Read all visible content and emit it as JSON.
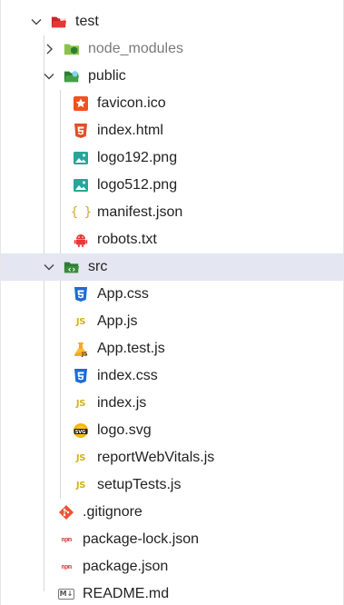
{
  "tree": {
    "root": {
      "name": "test",
      "icon": "folder-open-red-icon",
      "expanded": true
    },
    "items": [
      {
        "name": "node_modules",
        "type": "folder",
        "icon": "folder-node-icon",
        "expanded": false
      },
      {
        "name": "public",
        "type": "folder",
        "icon": "folder-public-icon",
        "expanded": true
      },
      {
        "name": "favicon.ico",
        "type": "file",
        "icon": "favicon-icon"
      },
      {
        "name": "index.html",
        "type": "file",
        "icon": "html-icon"
      },
      {
        "name": "logo192.png",
        "type": "file",
        "icon": "image-icon"
      },
      {
        "name": "logo512.png",
        "type": "file",
        "icon": "image-icon"
      },
      {
        "name": "manifest.json",
        "type": "file",
        "icon": "json-braces-icon",
        "glyph": "{ }"
      },
      {
        "name": "robots.txt",
        "type": "file",
        "icon": "robot-icon"
      },
      {
        "name": "src",
        "type": "folder",
        "icon": "folder-src-icon",
        "expanded": true,
        "selected": true
      },
      {
        "name": "App.css",
        "type": "file",
        "icon": "css-icon"
      },
      {
        "name": "App.js",
        "type": "file",
        "icon": "js-icon",
        "glyph": "JS"
      },
      {
        "name": "App.test.js",
        "type": "file",
        "icon": "test-js-icon"
      },
      {
        "name": "index.css",
        "type": "file",
        "icon": "css-icon"
      },
      {
        "name": "index.js",
        "type": "file",
        "icon": "js-icon",
        "glyph": "JS"
      },
      {
        "name": "logo.svg",
        "type": "file",
        "icon": "svg-icon"
      },
      {
        "name": "reportWebVitals.js",
        "type": "file",
        "icon": "js-icon",
        "glyph": "JS"
      },
      {
        "name": "setupTests.js",
        "type": "file",
        "icon": "js-icon",
        "glyph": "JS"
      },
      {
        "name": ".gitignore",
        "type": "file",
        "icon": "git-icon"
      },
      {
        "name": "package-lock.json",
        "type": "file",
        "icon": "npm-icon",
        "glyph": "npm"
      },
      {
        "name": "package.json",
        "type": "file",
        "icon": "npm-icon",
        "glyph": "npm"
      },
      {
        "name": "README.md",
        "type": "file",
        "icon": "markdown-icon",
        "glyph": "M↓"
      }
    ]
  },
  "colors": {
    "selection_bg": "#e4e6f1",
    "folder_red": "#e53935",
    "folder_green": "#4caf50",
    "html_orange": "#e44d26",
    "css_blue": "#1e6bd6",
    "js_yellow": "#d1b51b",
    "image_green": "#26a69a",
    "json_orange": "#d8a637",
    "git_red": "#f05033",
    "npm_red": "#cb3837"
  }
}
